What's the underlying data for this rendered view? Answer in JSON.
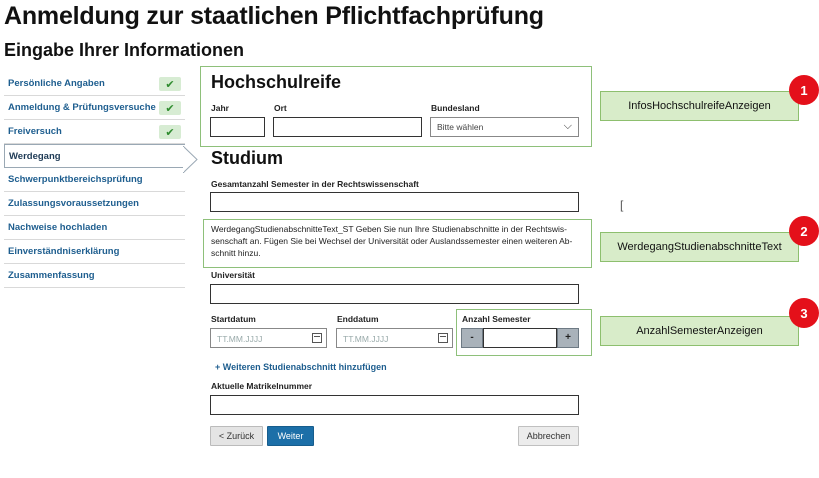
{
  "page": {
    "title": "Anmeldung zur staatlichen Pflichtfachprüfung",
    "subtitle": "Eingabe Ihrer Informationen"
  },
  "sidebar": {
    "items": [
      {
        "label": "Persönliche Angaben",
        "checked": true
      },
      {
        "label": "Anmeldung & Prüfungsversuche",
        "checked": true
      },
      {
        "label": "Freiversuch",
        "checked": true
      },
      {
        "label": "Werdegang",
        "active": true
      },
      {
        "label": "Schwerpunktbereichsprüfung"
      },
      {
        "label": "Zulassungsvoraussetzungen"
      },
      {
        "label": "Nachweise hochladen"
      },
      {
        "label": "Einverständniserklärung"
      },
      {
        "label": "Zusammenfassung"
      }
    ],
    "check_icon": "✔"
  },
  "hochschulreife": {
    "title": "Hochschulreife",
    "jahr_label": "Jahr",
    "jahr_value": "",
    "ort_label": "Ort",
    "ort_value": "",
    "bundesland_label": "Bundesland",
    "bundesland_value": "Bitte wählen"
  },
  "studium": {
    "title": "Studium",
    "gesamt_label": "Gesamtanzahl Semester in der Rechtswissenschaft",
    "gesamt_value": "",
    "info_text": "WerdegangStudienabschnitteText_ST Geben Sie nun Ihre Studienabschnitte in der Rechtswis-senschaft an. Fügen Sie bei Wechsel der Universität oder Auslandssemester einen weiteren Ab-schnitt hinzu.",
    "universitaet_label": "Universität",
    "universitaet_value": "",
    "startdatum_label": "Startdatum",
    "startdatum_placeholder": "TT.MM.JJJJ",
    "enddatum_label": "Enddatum",
    "enddatum_placeholder": "TT.MM.JJJJ",
    "anzahl_label": "Anzahl Semester",
    "anzahl_value": "",
    "minus": "-",
    "plus": "+",
    "add_link": "+ Weiteren Studienabschnitt hinzufügen",
    "matrikel_label": "Aktuelle Matrikelnummer",
    "matrikel_value": ""
  },
  "buttons": {
    "back": "< Zurück",
    "next": "Weiter",
    "cancel": "Abbrechen"
  },
  "annotations": [
    {
      "number": "1",
      "label": "InfosHochschulreifeAnzeigen"
    },
    {
      "number": "2",
      "label": "WerdegangStudienabschnitteText"
    },
    {
      "number": "3",
      "label": "AnzahlSemesterAnzeigen"
    }
  ],
  "colors": {
    "link": "#1e5e8f",
    "primary_button": "#1c6fa8",
    "highlight_border": "#8ec07a",
    "annotation_fill": "#d8ecc9",
    "badge": "#e4101a",
    "check": "#2e8b2e"
  }
}
